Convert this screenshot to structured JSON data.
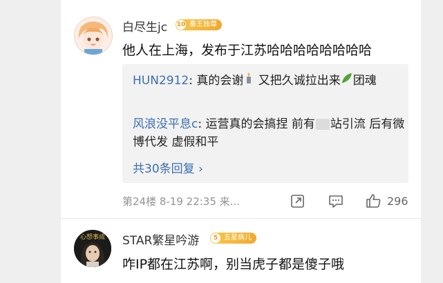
{
  "comments": [
    {
      "username": "白尽生jc",
      "badge_level": "10",
      "badge_label": "秦王独尊",
      "content": "他人在上海，发布于江苏哈哈哈哈哈哈哈哈",
      "replies": [
        {
          "user": "HUN2912",
          "sep": ":",
          "text_before_emoji": " 真的会谢",
          "emoji_1": "candle-emoji",
          "text_mid": " 又把久诚拉出来",
          "emoji_2": "leaf-emoji",
          "text_after": "团魂"
        },
        {
          "user": "风浪没平息c",
          "sep": ":",
          "text_before_blur": " 运营真的会搞捏 前有",
          "text_after_blur": "站引流 后有微博代发 虚假和平"
        }
      ],
      "more_replies": "共30条回复 ›",
      "meta": "第24楼  8-19 22:35  来...",
      "like_count": "296"
    },
    {
      "username": "STAR繁星吟游",
      "badge_level": "5",
      "badge_label": "五星病儿",
      "avatar_text": "心想事成",
      "content": "咋IP都在江苏啊，别当虎子都是傻子哦"
    }
  ],
  "icons": {
    "share": "share-icon",
    "comment": "comment-icon",
    "like": "thumbs-up-icon"
  },
  "colors": {
    "link_blue": "#3b6fb0",
    "badge_gold": "#f1a92e",
    "meta_gray": "#939393"
  }
}
